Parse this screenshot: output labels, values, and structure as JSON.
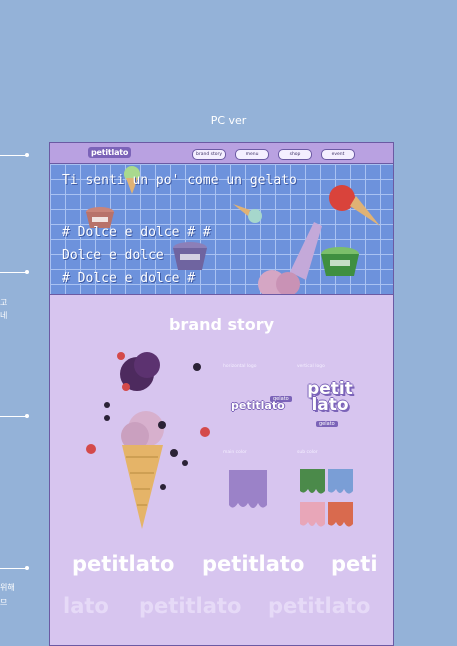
{
  "ver_title": "PC ver",
  "annotations": [
    "고",
    "네",
    "위해",
    "므"
  ],
  "nav": {
    "logo": "petitlato",
    "items": [
      "brand story",
      "menu",
      "shop",
      "event"
    ]
  },
  "hero": {
    "lines": [
      "Ti senti un po' come un gelato",
      "# Dolce e dolce # #",
      "Dolce e dolce",
      "# Dolce e dolce #"
    ]
  },
  "story": {
    "title": "brand story",
    "horizontal_label": "horizontal logo",
    "vertical_label": "vertical logo",
    "horizontal_logo": "petitlato",
    "vertical_logo_top": "petit",
    "vertical_logo_bottom": "lato",
    "gelato_tag": "gelato",
    "main_color_label": "main color",
    "sub_color_label": "sub color",
    "main_color": "#9b82c8",
    "sub_colors": [
      "#4b8a4a",
      "#7a9ed6",
      "#e8a6b8",
      "#d96a4e"
    ],
    "marquee_row1": [
      "petitlato",
      "petitlato",
      "peti"
    ],
    "marquee_row2": [
      "lato",
      "petitlato",
      "petitlato"
    ]
  }
}
